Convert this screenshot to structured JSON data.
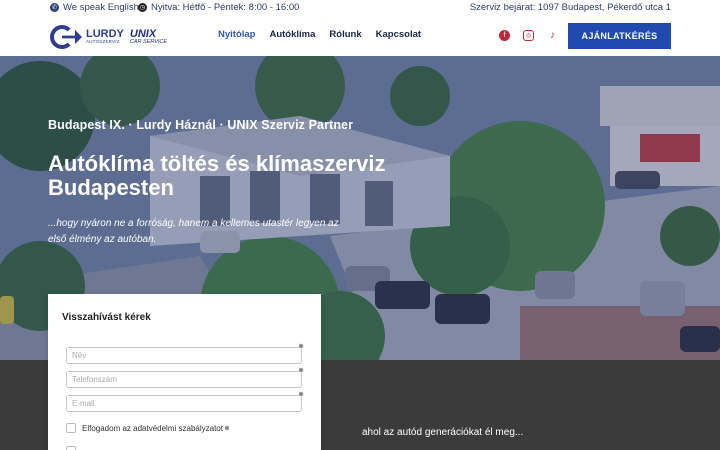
{
  "topbar": {
    "lang": "We speak English",
    "hours": "Nyitva: Hétfő - Péntek: 8:00 - 16:00",
    "address": "Szerviz bejárat: 1097 Budapest, Pékerdő utca 1"
  },
  "logo": {
    "brand": "LURDY",
    "brand_sub": "AUTÓSZERVIZ",
    "partner": "UNIX",
    "partner_sub": "CAR SERVICE"
  },
  "nav": [
    {
      "label": "Nyitólap",
      "active": true
    },
    {
      "label": "Autóklíma",
      "active": false
    },
    {
      "label": "Rólunk",
      "active": false
    },
    {
      "label": "Kapcsolat",
      "active": false
    }
  ],
  "socials": [
    "facebook-icon",
    "instagram-icon",
    "tiktok-icon"
  ],
  "cta": "AJÁNLATKÉRÉS",
  "hero": {
    "subtitle": "Budapest IX. · Lurdy Háznál · UNIX Szerviz Partner",
    "title": "Autóklíma töltés és klímaszerviz Budapesten",
    "text": "...hogy nyáron ne a forróság, hanem a kellemes utastér legyen az első élmény az autóban."
  },
  "form": {
    "title": "Visszahívást kérek",
    "name_placeholder": "Név",
    "phone_placeholder": "Telefonszám",
    "email_placeholder": "E-mail",
    "privacy_label": "Elfogadom az adatvédelmi szabályzatot"
  },
  "band_text": "ahol az autód generációkat él meg...",
  "colors": {
    "accent": "#1f4ab0",
    "nav_text": "#1a2550",
    "social": "#c0283c",
    "band": "#3b3b3b"
  }
}
